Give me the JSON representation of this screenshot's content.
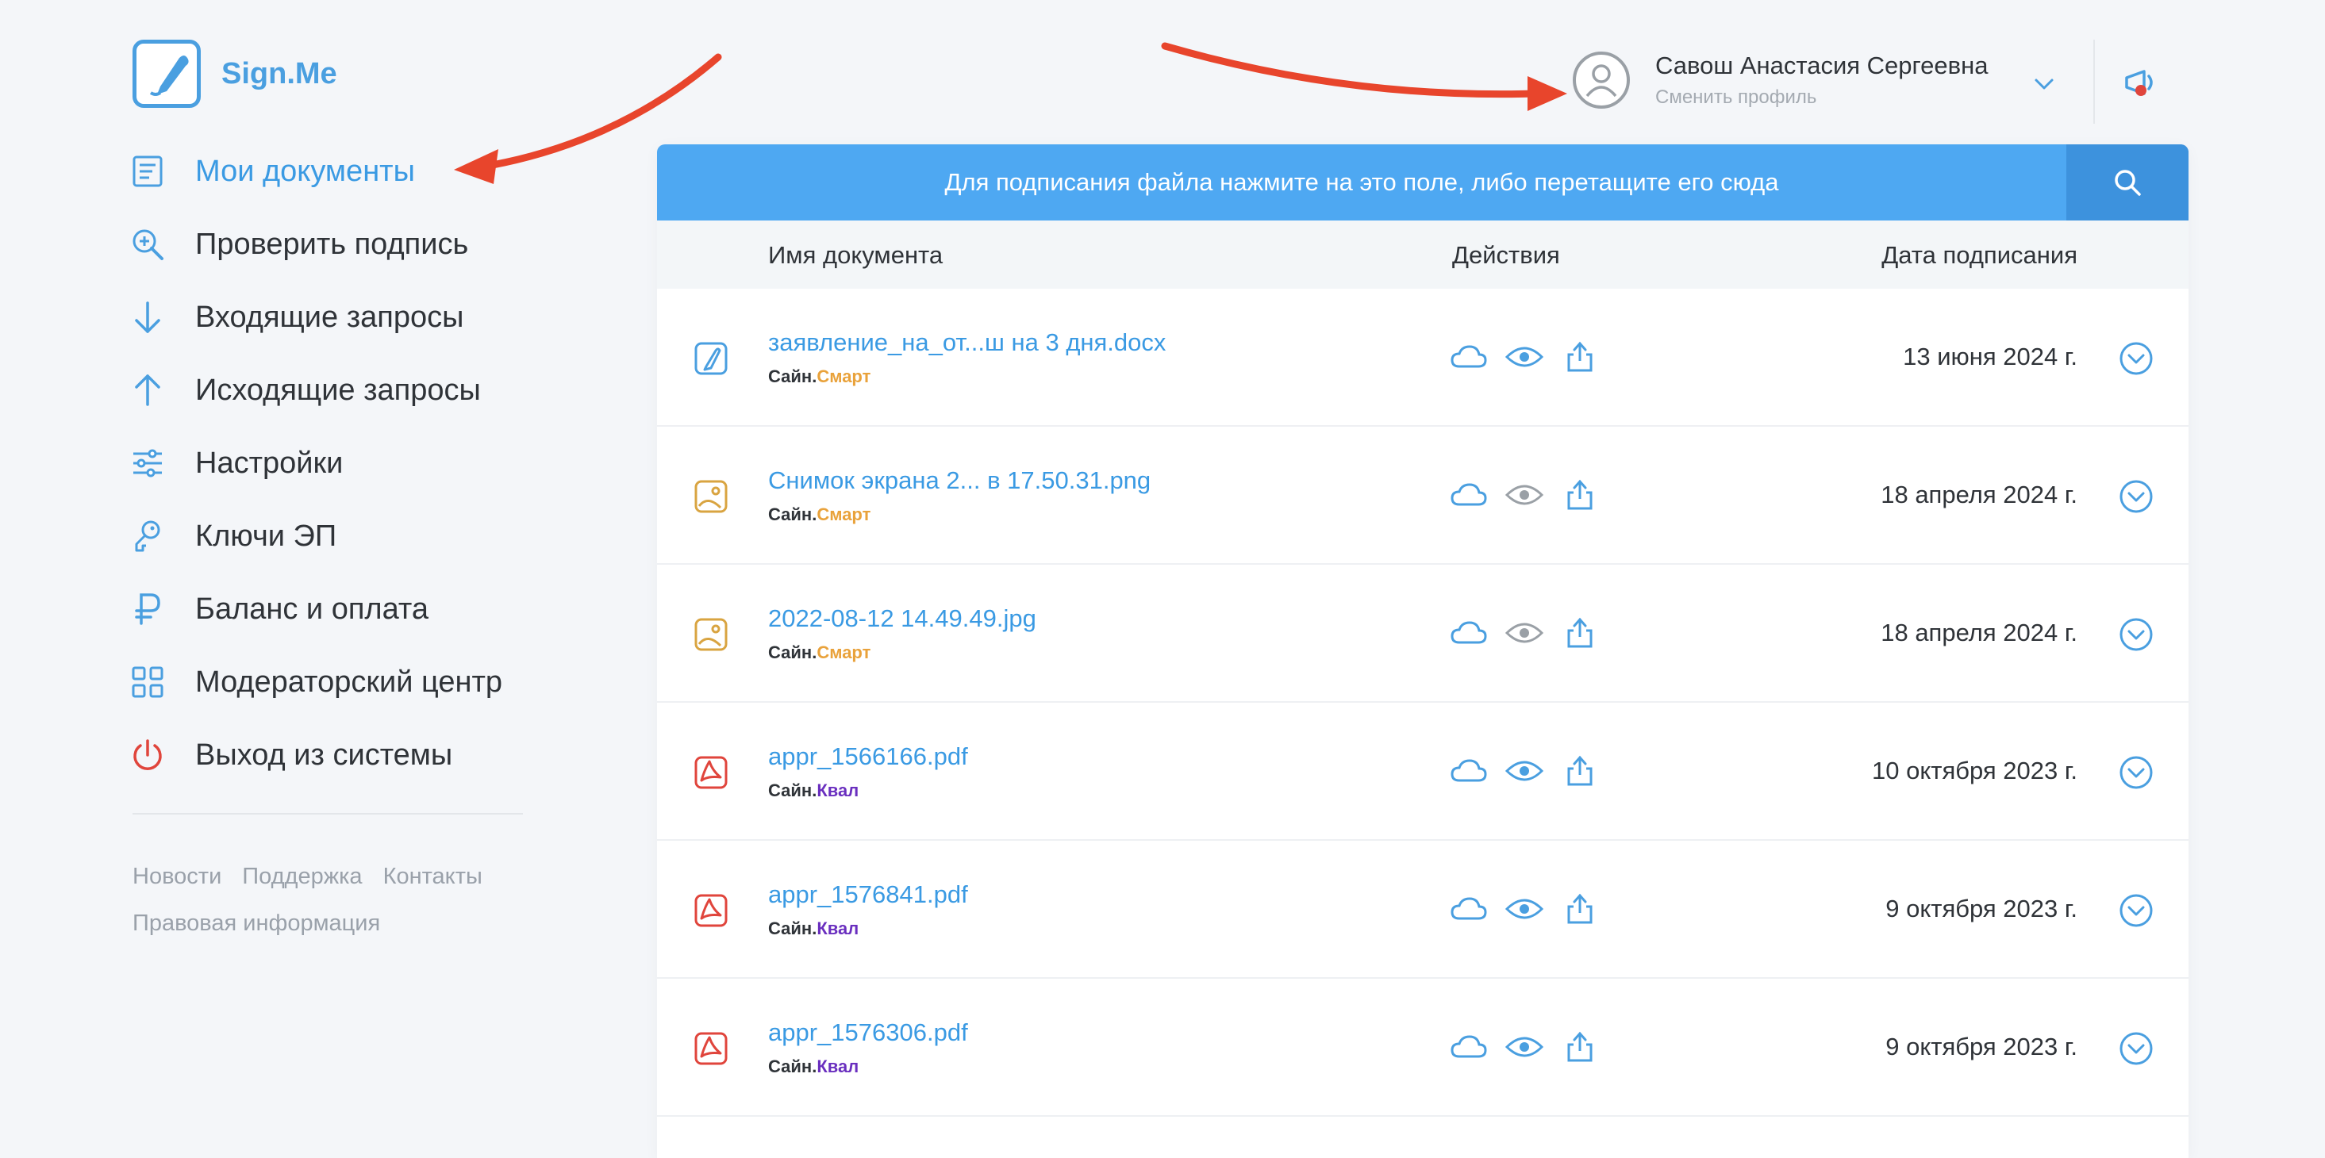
{
  "app": {
    "brand": "Sign.Me"
  },
  "sidebar": {
    "items": [
      {
        "label": "Мои документы",
        "icon": "document-icon",
        "active": true
      },
      {
        "label": "Проверить подпись",
        "icon": "zoom-check-icon"
      },
      {
        "label": "Входящие запросы",
        "icon": "arrow-down-icon"
      },
      {
        "label": "Исходящие запросы",
        "icon": "arrow-up-icon"
      },
      {
        "label": "Настройки",
        "icon": "sliders-icon"
      },
      {
        "label": "Ключи ЭП",
        "icon": "key-icon"
      },
      {
        "label": "Баланс и оплата",
        "icon": "ruble-icon"
      },
      {
        "label": "Модераторский центр",
        "icon": "grid-icon"
      },
      {
        "label": "Выход из системы",
        "icon": "power-icon"
      }
    ],
    "footer": {
      "news": "Новости",
      "support": "Поддержка",
      "contacts": "Контакты",
      "legal": "Правовая информация"
    }
  },
  "header": {
    "user_name": "Савош Анастасия Сергеевна",
    "switch_profile": "Сменить профиль"
  },
  "upload": {
    "hint": "Для подписания файла нажмите на это поле, либо перетащите его сюда"
  },
  "table": {
    "columns": {
      "name": "Имя документа",
      "actions": "Действия",
      "date": "Дата подписания"
    },
    "tag_prefix": "Сайн.",
    "rows": [
      {
        "name": "заявление_на_от...ш на 3 дня.docx",
        "tag": "Смарт",
        "date": "13 июня 2024 г.",
        "type": "docx",
        "preview": true
      },
      {
        "name": "Снимок экрана 2... в 17.50.31.png",
        "tag": "Смарт",
        "date": "18 апреля 2024 г.",
        "type": "image",
        "preview": false
      },
      {
        "name": "2022-08-12 14.49.49.jpg",
        "tag": "Смарт",
        "date": "18 апреля 2024 г.",
        "type": "image",
        "preview": false
      },
      {
        "name": "appr_1566166.pdf",
        "tag": "Квал",
        "date": "10 октября 2023 г.",
        "type": "pdf",
        "preview": true
      },
      {
        "name": "appr_1576841.pdf",
        "tag": "Квал",
        "date": "9 октября 2023 г.",
        "type": "pdf",
        "preview": true
      },
      {
        "name": "appr_1576306.pdf",
        "tag": "Квал",
        "date": "9 октября 2023 г.",
        "type": "pdf",
        "preview": true
      }
    ]
  },
  "colors": {
    "accent": "#3a9ae3",
    "upload_bar": "#4ea8f2",
    "smart_tag": "#e9a23b",
    "kval_tag": "#6a2fbf",
    "pdf_icon": "#e0453c",
    "image_icon": "#d9a441",
    "annotation_arrow": "#e8452c"
  }
}
